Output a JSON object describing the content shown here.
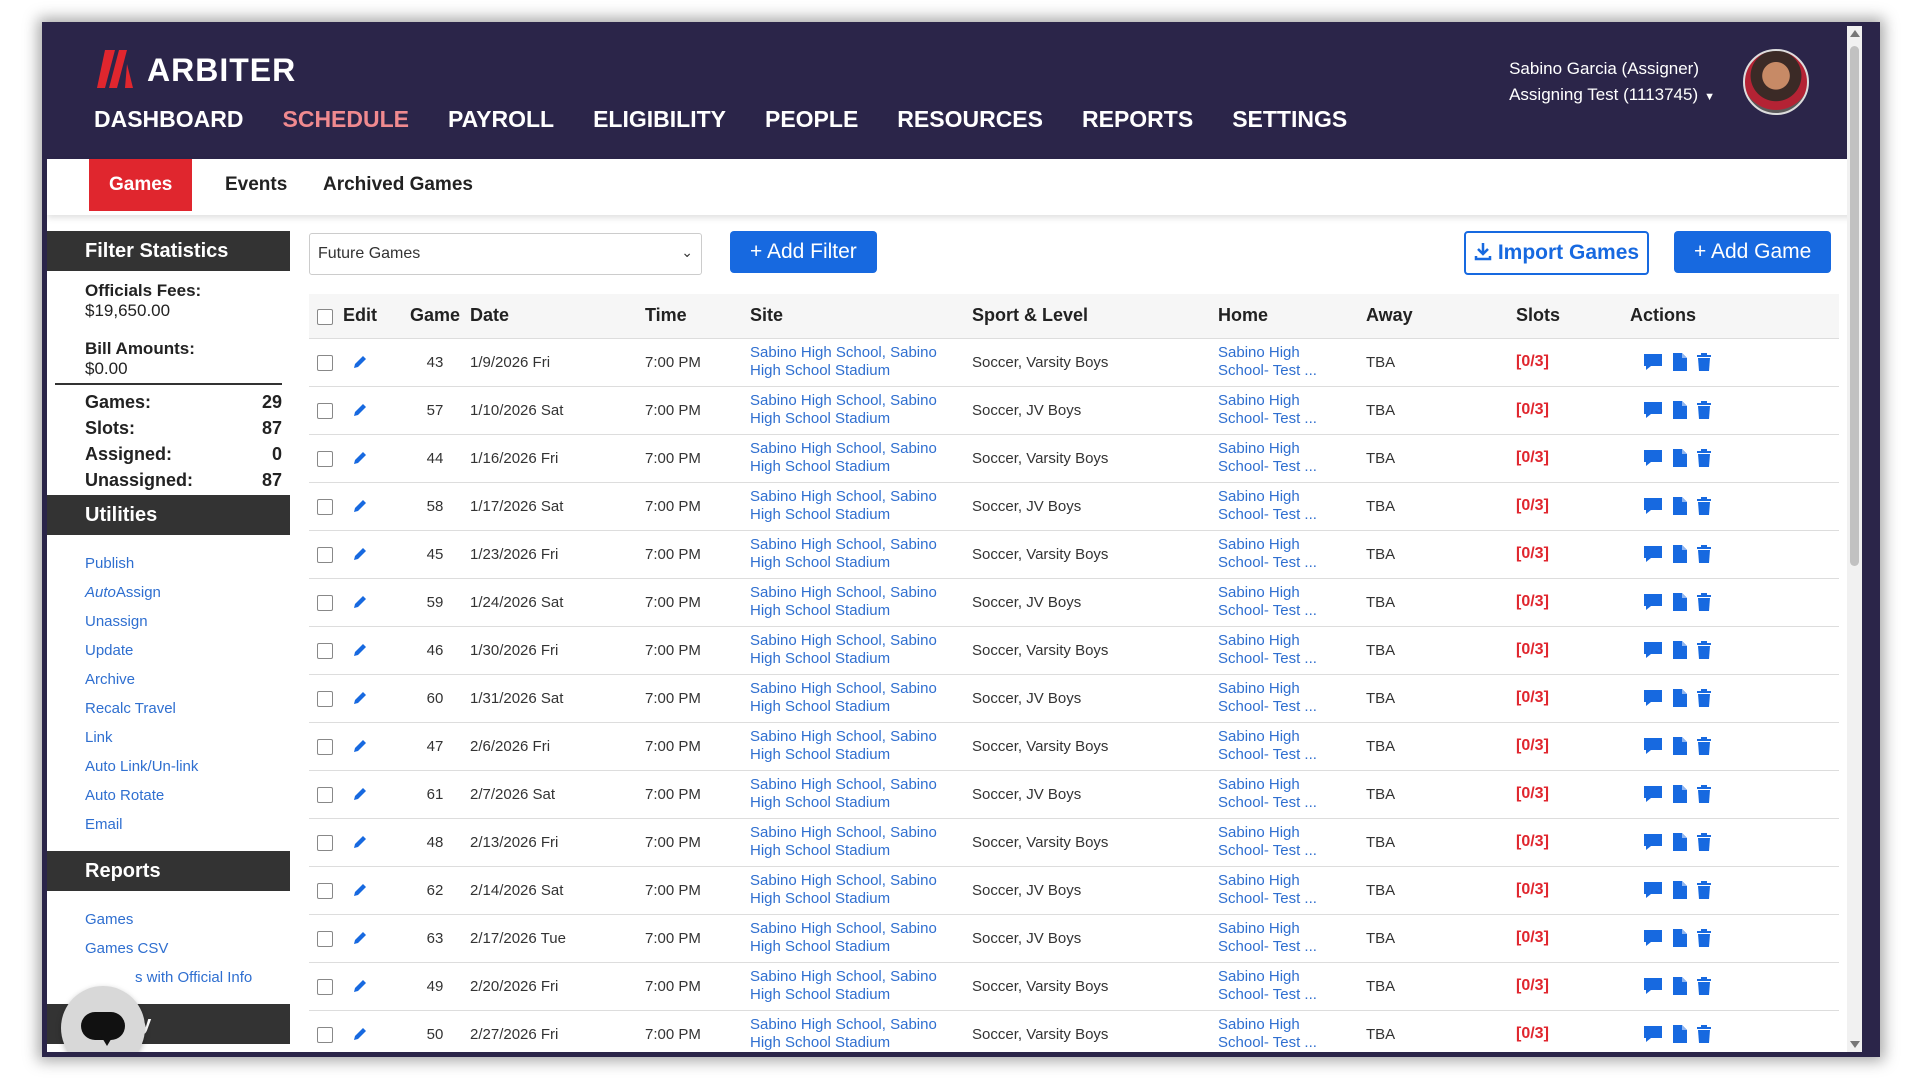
{
  "brand": {
    "name": "ARBITER",
    "accent": "#e0262e",
    "nav_bg": "#2b2549",
    "link": "#2f6fd0"
  },
  "nav": [
    {
      "label": "DASHBOARD",
      "active": false
    },
    {
      "label": "SCHEDULE",
      "active": true
    },
    {
      "label": "PAYROLL",
      "active": false
    },
    {
      "label": "ELIGIBILITY",
      "active": false
    },
    {
      "label": "PEOPLE",
      "active": false
    },
    {
      "label": "RESOURCES",
      "active": false
    },
    {
      "label": "REPORTS",
      "active": false
    },
    {
      "label": "SETTINGS",
      "active": false
    }
  ],
  "user": {
    "name": "Sabino Garcia (Assigner)",
    "account": "Assigning Test (1113745)"
  },
  "subnav": [
    {
      "label": "Games",
      "active": true
    },
    {
      "label": "Events",
      "active": false
    },
    {
      "label": "Archived Games",
      "active": false
    }
  ],
  "sidebar": {
    "filter_title": "Filter Statistics",
    "officials_fees_label": "Officials Fees:",
    "officials_fees_value": "$19,650.00",
    "bill_amounts_label": "Bill Amounts:",
    "bill_amounts_value": "$0.00",
    "counts": [
      {
        "label": "Games:",
        "value": "29"
      },
      {
        "label": "Slots:",
        "value": "87"
      },
      {
        "label": "Assigned:",
        "value": "0"
      },
      {
        "label": "Unassigned:",
        "value": "87"
      }
    ],
    "utilities_title": "Utilities",
    "utilities": [
      "Publish",
      "AutoAssign",
      "Unassign",
      "Update",
      "Archive",
      "Recalc Travel",
      "Link",
      "Auto Link/Un-link",
      "Auto Rotate",
      "Email"
    ],
    "reports_title": "Reports",
    "reports": [
      "Games",
      "Games CSV",
      "s with Official Info"
    ],
    "next_title": "ay"
  },
  "toolbar": {
    "filter_select": "Future Games",
    "add_filter": "+ Add Filter",
    "import_games": "Import Games",
    "add_game": "+ Add Game"
  },
  "table": {
    "headers": {
      "edit": "Edit",
      "game": "Game",
      "date": "Date",
      "time": "Time",
      "site": "Site",
      "sport": "Sport & Level",
      "home": "Home",
      "away": "Away",
      "slots": "Slots",
      "actions": "Actions"
    },
    "rows": [
      {
        "game": "43",
        "date": "1/9/2026 Fri",
        "time": "7:00 PM",
        "site1": "Sabino High School, Sabino",
        "site2": "High School Stadium",
        "sport": "Soccer, Varsity Boys",
        "home1": "Sabino High",
        "home2": "School- Test ...",
        "away": "TBA",
        "slots": "[0/3]"
      },
      {
        "game": "57",
        "date": "1/10/2026 Sat",
        "time": "7:00 PM",
        "site1": "Sabino High School, Sabino",
        "site2": "High School Stadium",
        "sport": "Soccer, JV Boys",
        "home1": "Sabino High",
        "home2": "School- Test ...",
        "away": "TBA",
        "slots": "[0/3]"
      },
      {
        "game": "44",
        "date": "1/16/2026 Fri",
        "time": "7:00 PM",
        "site1": "Sabino High School, Sabino",
        "site2": "High School Stadium",
        "sport": "Soccer, Varsity Boys",
        "home1": "Sabino High",
        "home2": "School- Test ...",
        "away": "TBA",
        "slots": "[0/3]"
      },
      {
        "game": "58",
        "date": "1/17/2026 Sat",
        "time": "7:00 PM",
        "site1": "Sabino High School, Sabino",
        "site2": "High School Stadium",
        "sport": "Soccer, JV Boys",
        "home1": "Sabino High",
        "home2": "School- Test ...",
        "away": "TBA",
        "slots": "[0/3]"
      },
      {
        "game": "45",
        "date": "1/23/2026 Fri",
        "time": "7:00 PM",
        "site1": "Sabino High School, Sabino",
        "site2": "High School Stadium",
        "sport": "Soccer, Varsity Boys",
        "home1": "Sabino High",
        "home2": "School- Test ...",
        "away": "TBA",
        "slots": "[0/3]"
      },
      {
        "game": "59",
        "date": "1/24/2026 Sat",
        "time": "7:00 PM",
        "site1": "Sabino High School, Sabino",
        "site2": "High School Stadium",
        "sport": "Soccer, JV Boys",
        "home1": "Sabino High",
        "home2": "School- Test ...",
        "away": "TBA",
        "slots": "[0/3]"
      },
      {
        "game": "46",
        "date": "1/30/2026 Fri",
        "time": "7:00 PM",
        "site1": "Sabino High School, Sabino",
        "site2": "High School Stadium",
        "sport": "Soccer, Varsity Boys",
        "home1": "Sabino High",
        "home2": "School- Test ...",
        "away": "TBA",
        "slots": "[0/3]"
      },
      {
        "game": "60",
        "date": "1/31/2026 Sat",
        "time": "7:00 PM",
        "site1": "Sabino High School, Sabino",
        "site2": "High School Stadium",
        "sport": "Soccer, JV Boys",
        "home1": "Sabino High",
        "home2": "School- Test ...",
        "away": "TBA",
        "slots": "[0/3]"
      },
      {
        "game": "47",
        "date": "2/6/2026 Fri",
        "time": "7:00 PM",
        "site1": "Sabino High School, Sabino",
        "site2": "High School Stadium",
        "sport": "Soccer, Varsity Boys",
        "home1": "Sabino High",
        "home2": "School- Test ...",
        "away": "TBA",
        "slots": "[0/3]"
      },
      {
        "game": "61",
        "date": "2/7/2026 Sat",
        "time": "7:00 PM",
        "site1": "Sabino High School, Sabino",
        "site2": "High School Stadium",
        "sport": "Soccer, JV Boys",
        "home1": "Sabino High",
        "home2": "School- Test ...",
        "away": "TBA",
        "slots": "[0/3]"
      },
      {
        "game": "48",
        "date": "2/13/2026 Fri",
        "time": "7:00 PM",
        "site1": "Sabino High School, Sabino",
        "site2": "High School Stadium",
        "sport": "Soccer, Varsity Boys",
        "home1": "Sabino High",
        "home2": "School- Test ...",
        "away": "TBA",
        "slots": "[0/3]"
      },
      {
        "game": "62",
        "date": "2/14/2026 Sat",
        "time": "7:00 PM",
        "site1": "Sabino High School, Sabino",
        "site2": "High School Stadium",
        "sport": "Soccer, JV Boys",
        "home1": "Sabino High",
        "home2": "School- Test ...",
        "away": "TBA",
        "slots": "[0/3]"
      },
      {
        "game": "63",
        "date": "2/17/2026 Tue",
        "time": "7:00 PM",
        "site1": "Sabino High School, Sabino",
        "site2": "High School Stadium",
        "sport": "Soccer, JV Boys",
        "home1": "Sabino High",
        "home2": "School- Test ...",
        "away": "TBA",
        "slots": "[0/3]"
      },
      {
        "game": "49",
        "date": "2/20/2026 Fri",
        "time": "7:00 PM",
        "site1": "Sabino High School, Sabino",
        "site2": "High School Stadium",
        "sport": "Soccer, Varsity Boys",
        "home1": "Sabino High",
        "home2": "School- Test ...",
        "away": "TBA",
        "slots": "[0/3]"
      },
      {
        "game": "50",
        "date": "2/27/2026 Fri",
        "time": "7:00 PM",
        "site1": "Sabino High School, Sabino",
        "site2": "High School Stadium",
        "sport": "Soccer, Varsity Boys",
        "home1": "Sabino High",
        "home2": "School- Test ...",
        "away": "TBA",
        "slots": "[0/3]"
      }
    ],
    "row_actions": [
      "comment-icon",
      "document-icon",
      "trash-icon"
    ]
  }
}
